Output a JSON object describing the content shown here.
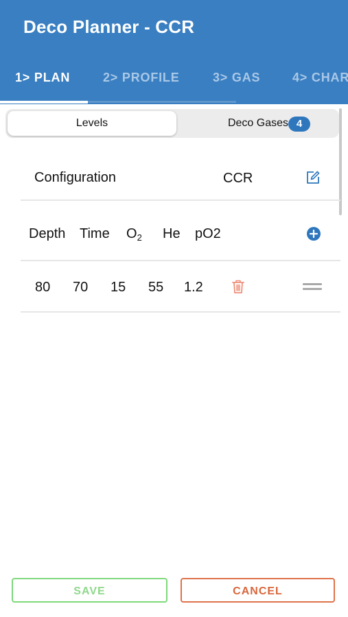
{
  "app": {
    "title": "Deco Planner - CCR"
  },
  "tabs": [
    {
      "label": "1> PLAN",
      "active": true
    },
    {
      "label": "2> PROFILE",
      "active": false
    },
    {
      "label": "3> GAS",
      "active": false
    },
    {
      "label": "4> CHAR",
      "active": false
    }
  ],
  "segments": {
    "levels": "Levels",
    "deco_gases": "Deco Gases",
    "deco_gases_count": "4"
  },
  "configuration": {
    "label": "Configuration",
    "value": "CCR",
    "edit_icon": "edit-icon"
  },
  "levels_table": {
    "headers": {
      "depth": "Depth",
      "time": "Time",
      "o2_base": "O",
      "o2_sub": "2",
      "he": "He",
      "po2": "pO2"
    },
    "add_icon": "add-circle-icon",
    "rows": [
      {
        "depth": "80",
        "time": "70",
        "o2": "15",
        "he": "55",
        "po2": "1.2"
      }
    ],
    "delete_icon": "trash-icon",
    "drag_icon": "drag-handle-icon"
  },
  "actions": {
    "save": "SAVE",
    "cancel": "CANCEL"
  },
  "colors": {
    "header_bg": "#3a7fc1",
    "accent_blue": "#2f77bd",
    "save_green": "#7dd87a",
    "cancel_orange": "#de7148",
    "delete_red": "#ee8f7a"
  }
}
